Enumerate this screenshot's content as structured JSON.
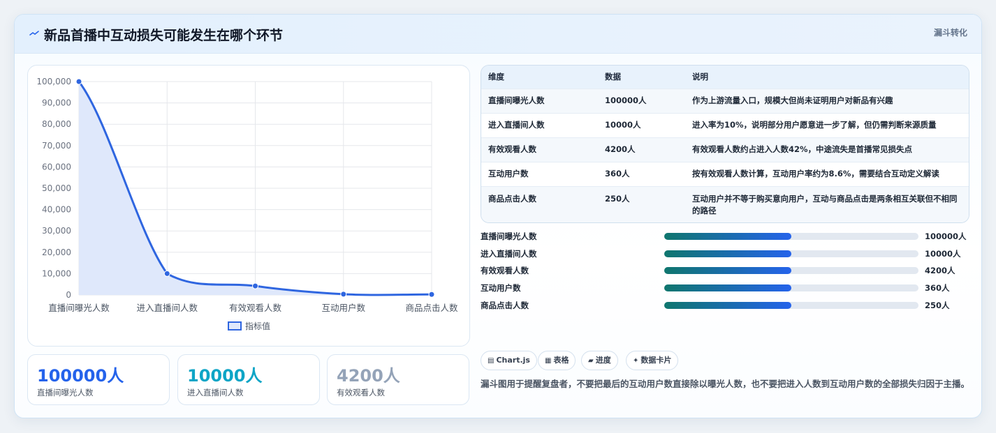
{
  "header": {
    "title": "新品首播中互动损失可能发生在哪个环节",
    "tag": "漏斗转化"
  },
  "chart_data": {
    "type": "line",
    "categories": [
      "直播间曝光人数",
      "进入直播间人数",
      "有效观看人数",
      "互动用户数",
      "商品点击人数"
    ],
    "series": [
      {
        "name": "指标值",
        "values": [
          100000,
          10000,
          4200,
          360,
          250
        ]
      }
    ],
    "ylim": [
      0,
      100000
    ],
    "yticks": [
      "0",
      "10,000",
      "20,000",
      "30,000",
      "40,000",
      "50,000",
      "60,000",
      "70,000",
      "80,000",
      "90,000",
      "100,000"
    ],
    "grid": true,
    "legend": "bottom",
    "color": "#2f66e0",
    "fill_color": "#dfe8fb"
  },
  "kpis": [
    {
      "value": "100000人",
      "label": "直播间曝光人数",
      "color": "#2563eb"
    },
    {
      "value": "10000人",
      "label": "进入直播间人数",
      "color": "#0ea5c6"
    },
    {
      "value": "4200人",
      "label": "有效观看人数",
      "color": "#94a3b8"
    }
  ],
  "table": {
    "headers": [
      "维度",
      "数据",
      "说明"
    ],
    "rows": [
      {
        "dim": "直播间曝光人数",
        "val": "100000人",
        "note": "作为上游流量入口，规模大但尚未证明用户对新品有兴趣"
      },
      {
        "dim": "进入直播间人数",
        "val": "10000人",
        "note": "进入率为10%，说明部分用户愿意进一步了解，但仍需判断来源质量"
      },
      {
        "dim": "有效观看人数",
        "val": "4200人",
        "note": "有效观看人数约占进入人数42%，中途流失是首播常见损失点"
      },
      {
        "dim": "互动用户数",
        "val": "360人",
        "note": "按有效观看人数计算，互动用户率约为8.6%，需要结合互动定义解读"
      },
      {
        "dim": "商品点击人数",
        "val": "250人",
        "note": "互动用户并不等于购买意向用户，互动与商品点击是两条相互关联但不相同的路径"
      }
    ]
  },
  "bars": [
    {
      "label": "直播间曝光人数",
      "value": "100000人",
      "fill_fraction": 0.5
    },
    {
      "label": "进入直播间人数",
      "value": "10000人",
      "fill_fraction": 0.5
    },
    {
      "label": "有效观看人数",
      "value": "4200人",
      "fill_fraction": 0.5
    },
    {
      "label": "互动用户数",
      "value": "360人",
      "fill_fraction": 0.5
    },
    {
      "label": "商品点击人数",
      "value": "250人",
      "fill_fraction": 0.5
    }
  ],
  "chips": [
    {
      "icon": "chart-icon",
      "glyph": "▤",
      "label": "Chart.js"
    },
    {
      "icon": "table-icon",
      "glyph": "▦",
      "label": "表格"
    },
    {
      "icon": "progress-icon",
      "glyph": "▰",
      "label": "进度"
    },
    {
      "icon": "card-icon",
      "glyph": "✦",
      "label": "数据卡片"
    }
  ],
  "note": "漏斗图用于提醒复盘者，不要把最后的互动用户数直接除以曝光人数，也不要把进入人数到互动用户数的全部损失归因于主播。"
}
